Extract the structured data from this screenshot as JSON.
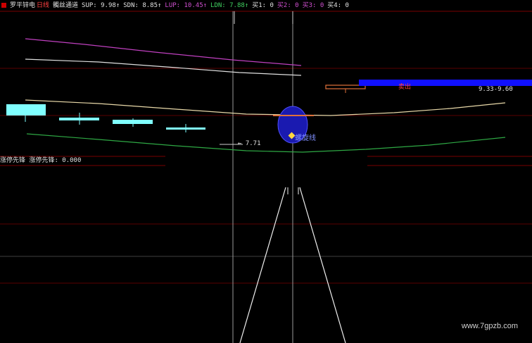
{
  "header": {
    "stock_name": "罗平锌电",
    "period": "日线",
    "indicator": "髑丝通道",
    "sup": "SUP: 9.98↑",
    "sdn": "SDN: 8.85↑",
    "lup": "LUP: 10.45↑",
    "ldn": "LDN: 7.88↑",
    "buy1": "买1: 0",
    "buy2": "买2: 0",
    "buy3": "买3: 0",
    "buy4": "买4: 0"
  },
  "chart": {
    "sell_label": "卖出",
    "price_range": "9.33-9.60",
    "low_label": "← 7.71",
    "spiral_label": "螺旋线"
  },
  "sub_panel": {
    "title": "涨停先锋",
    "value_text": "涨停先锋: 0.000"
  },
  "colors": {
    "background": "#000000",
    "magenta_line": "#c040c0",
    "white_line": "#e0e0e0",
    "beige_line": "#e8d8a8",
    "green_line": "#2ea844",
    "cyan_candle": "#80ffff",
    "blue_band": "#1010ff",
    "red_grid": "#7a0000"
  },
  "watermark": "www.7gpzb.com"
}
